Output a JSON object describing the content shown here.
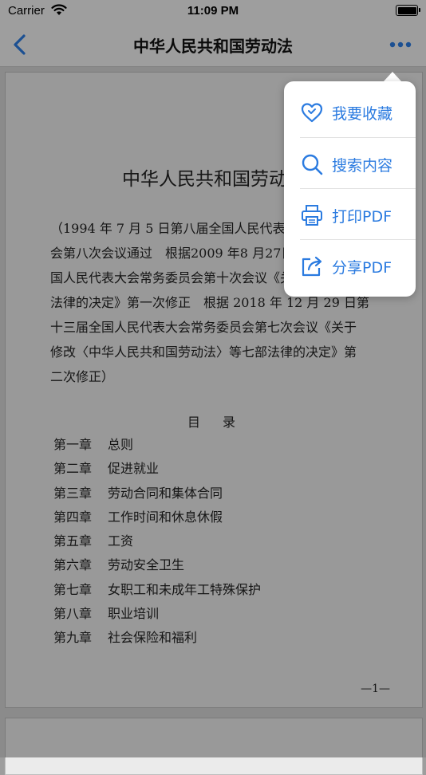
{
  "status_bar": {
    "carrier": "Carrier",
    "time": "11:09 PM"
  },
  "nav": {
    "title": "中华人民共和国劳动法"
  },
  "document": {
    "title": "中华人民共和国劳动法",
    "preamble_lines": [
      "（1994 年 7 月 5 日第八届全国人民代表大会常务委员",
      "会第八次会议通过　根据2009 年8 月27日第十一届全",
      "国人民代表大会常务委员会第十次会议《关于修改部分",
      "法律的决定》第一次修正　根据 2018 年 12 月 29 日第",
      "十三届全国人民代表大会常务委员会第七次会议《关于",
      "修改〈中华人民共和国劳动法〉等七部法律的决定》第",
      "二次修正）"
    ],
    "toc_heading": "目　录",
    "toc": [
      {
        "chapter": "第一章",
        "title": "总则"
      },
      {
        "chapter": "第二章",
        "title": "促进就业"
      },
      {
        "chapter": "第三章",
        "title": "劳动合同和集体合同"
      },
      {
        "chapter": "第四章",
        "title": "工作时间和休息休假"
      },
      {
        "chapter": "第五章",
        "title": "工资"
      },
      {
        "chapter": "第六章",
        "title": "劳动安全卫生"
      },
      {
        "chapter": "第七章",
        "title": "女职工和未成年工特殊保护"
      },
      {
        "chapter": "第八章",
        "title": "职业培训"
      },
      {
        "chapter": "第九章",
        "title": "社会保险和福利"
      }
    ],
    "page_number": "—1—"
  },
  "menu": {
    "items": [
      {
        "label": "我要收藏",
        "icon": "heart-icon"
      },
      {
        "label": "搜索内容",
        "icon": "search-icon"
      },
      {
        "label": "打印PDF",
        "icon": "printer-icon"
      },
      {
        "label": "分享PDF",
        "icon": "share-icon"
      }
    ]
  },
  "colors": {
    "accent": "#2b7be0",
    "nav_bg": "#f3f3f3",
    "page_bg": "#ebebeb"
  }
}
